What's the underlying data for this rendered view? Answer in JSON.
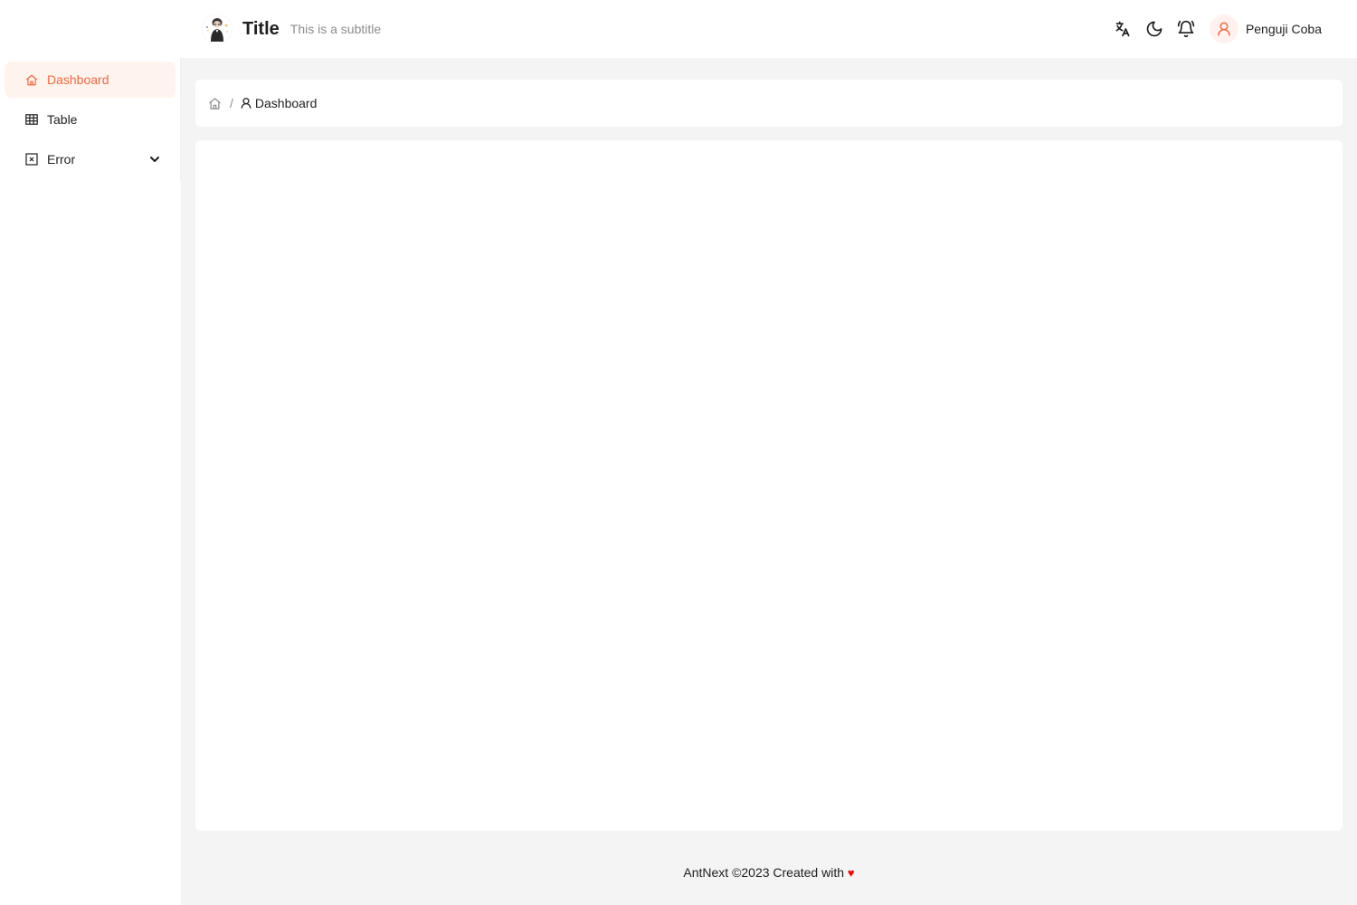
{
  "header": {
    "title": "Title",
    "subtitle": "This is a subtitle",
    "icons": [
      "translate-icon",
      "moon-icon",
      "bell-icon"
    ],
    "user": {
      "name": "Penguji Coba",
      "avatar_icon": "user-icon"
    }
  },
  "sidebar": {
    "items": [
      {
        "label": "Dashboard",
        "icon": "home-icon",
        "active": true
      },
      {
        "label": "Table",
        "icon": "table-icon",
        "active": false
      },
      {
        "label": "Error",
        "icon": "close-square-icon",
        "active": false,
        "expandable": true
      }
    ]
  },
  "breadcrumb": {
    "separator": "/",
    "current": "Dashboard"
  },
  "footer": {
    "text": "AntNext ©2023 Created with",
    "heart": "♥"
  },
  "colors": {
    "accent": "#f3683f",
    "accent_bg": "#fff3ee",
    "main_bg": "#f4f4f4",
    "heart": "#ff0000"
  }
}
